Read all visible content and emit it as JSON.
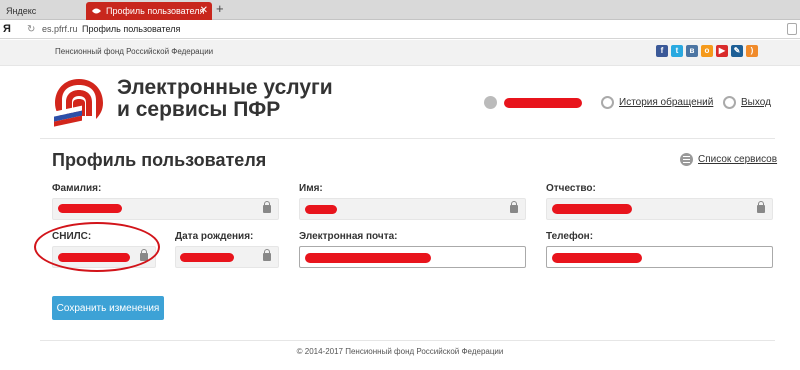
{
  "browser": {
    "tabs": [
      {
        "label": "Яндекс",
        "active": false
      },
      {
        "label": "Профиль пользователя",
        "active": true
      }
    ],
    "new_tab": "+",
    "close": "✕",
    "logo": "Я",
    "url": "es.pfrf.ru",
    "page_title": "Профиль пользователя"
  },
  "header": {
    "org_name": "Пенсионный фонд Российской Федерации",
    "social_icons": [
      "facebook-icon",
      "twitter-icon",
      "vk-icon",
      "odnoklassniki-icon",
      "youtube-icon",
      "livejournal-icon",
      "rss-icon"
    ],
    "brand_line1": "Электронные услуги",
    "brand_line2": "и сервисы ПФР",
    "history_link": "История обращений",
    "logout_link": "Выход"
  },
  "profile": {
    "title": "Профиль пользователя",
    "services_link": "Список сервисов",
    "fields": {
      "surname": {
        "label": "Фамилия:"
      },
      "name": {
        "label": "Имя:"
      },
      "patronymic": {
        "label": "Отчество:"
      },
      "snils": {
        "label": "СНИЛС:"
      },
      "birthdate": {
        "label": "Дата рождения:"
      },
      "email": {
        "label": "Электронная почта:"
      },
      "phone": {
        "label": "Телефон:"
      }
    },
    "save_button": "Сохранить изменения"
  },
  "footer": {
    "copyright": "© 2014-2017 Пенсионный фонд Российской Федерации"
  },
  "colors": {
    "accent_red": "#c8271d",
    "redaction": "#e8141c",
    "button_blue": "#3da2d6"
  }
}
